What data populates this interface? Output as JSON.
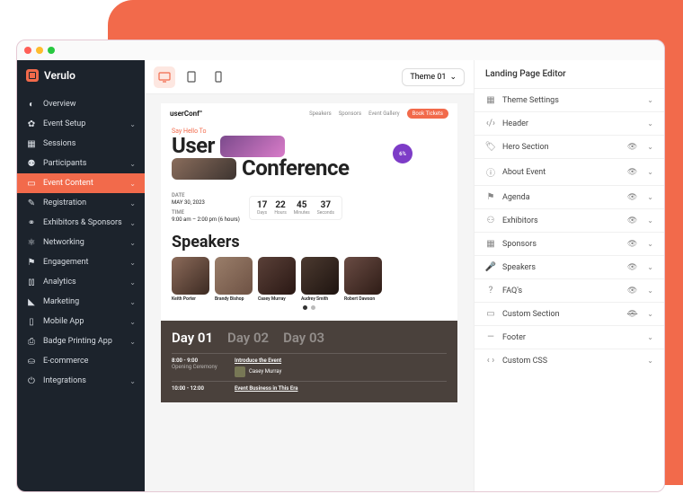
{
  "brand": "Verulo",
  "sidebar": {
    "items": [
      {
        "icon": "gauge",
        "label": "Overview",
        "expandable": false
      },
      {
        "icon": "gear",
        "label": "Event Setup",
        "expandable": true
      },
      {
        "icon": "grid",
        "label": "Sessions",
        "expandable": false
      },
      {
        "icon": "users",
        "label": "Participants",
        "expandable": true
      },
      {
        "icon": "calendar",
        "label": "Event Content",
        "expandable": true,
        "active": true
      },
      {
        "icon": "user-plus",
        "label": "Registration",
        "expandable": true
      },
      {
        "icon": "handshake",
        "label": "Exhibitors & Sponsors",
        "expandable": true
      },
      {
        "icon": "network",
        "label": "Networking",
        "expandable": true
      },
      {
        "icon": "flag",
        "label": "Engagement",
        "expandable": true
      },
      {
        "icon": "bars",
        "label": "Analytics",
        "expandable": true
      },
      {
        "icon": "megaphone",
        "label": "Marketing",
        "expandable": true
      },
      {
        "icon": "phone",
        "label": "Mobile App",
        "expandable": true
      },
      {
        "icon": "printer",
        "label": "Badge Printing App",
        "expandable": true
      },
      {
        "icon": "cart",
        "label": "E-commerce",
        "expandable": false
      },
      {
        "icon": "plug",
        "label": "Integrations",
        "expandable": true
      }
    ]
  },
  "toolbar": {
    "devices": [
      "desktop",
      "tablet",
      "mobile"
    ],
    "theme_label": "Theme 01"
  },
  "preview": {
    "logo": "userConf°",
    "nav": [
      "Speakers",
      "Sponsors",
      "Event Gallery"
    ],
    "cta": "Book Tickets",
    "hero_sub": "Say Hello To",
    "hero_line1": "User",
    "hero_line2": "Conference",
    "hero_badge": "6%",
    "date": {
      "label": "DATE",
      "value": "MAY 30, 2023"
    },
    "time": {
      "label": "TIME",
      "value": "9:00 am – 2:00 pm (6 hours)"
    },
    "countdown": [
      {
        "n": "17",
        "l": "Days"
      },
      {
        "n": "22",
        "l": "Hours"
      },
      {
        "n": "45",
        "l": "Minutes"
      },
      {
        "n": "37",
        "l": "Seconds"
      }
    ],
    "speakers_heading": "Speakers",
    "speakers": [
      {
        "name": "Keith Porter"
      },
      {
        "name": "Brandy Bishop"
      },
      {
        "name": "Casey Murray"
      },
      {
        "name": "Audrey Smith"
      },
      {
        "name": "Robert Dawson"
      }
    ],
    "agenda": {
      "tabs": [
        "Day 01",
        "Day 02",
        "Day 03"
      ],
      "slots": [
        {
          "time": "8:00 - 9:00",
          "sub": "Opening Ceremony",
          "title": "Introduce the Event",
          "who": "Casey Murray"
        },
        {
          "time": "10:00 - 12:00",
          "sub": "",
          "title": "Event Business in This Era",
          "who": ""
        }
      ]
    }
  },
  "editor": {
    "title": "Landing Page Editor",
    "sections": [
      {
        "icon": "grid",
        "label": "Theme Settings",
        "eye": false
      },
      {
        "icon": "code",
        "label": "Header",
        "eye": false
      },
      {
        "icon": "tag",
        "label": "Hero Section",
        "eye": true
      },
      {
        "icon": "info",
        "label": "About Event",
        "eye": true
      },
      {
        "icon": "flag",
        "label": "Agenda",
        "eye": true
      },
      {
        "icon": "user",
        "label": "Exhibitors",
        "eye": true
      },
      {
        "icon": "grid",
        "label": "Sponsors",
        "eye": true
      },
      {
        "icon": "mic",
        "label": "Speakers",
        "eye": true
      },
      {
        "icon": "help",
        "label": "FAQ's",
        "eye": true
      },
      {
        "icon": "layout",
        "label": "Custom Section",
        "eye": true,
        "hidden": true
      },
      {
        "icon": "minus",
        "label": "Footer",
        "eye": false
      },
      {
        "icon": "code",
        "label": "Custom CSS",
        "eye": false
      }
    ]
  }
}
